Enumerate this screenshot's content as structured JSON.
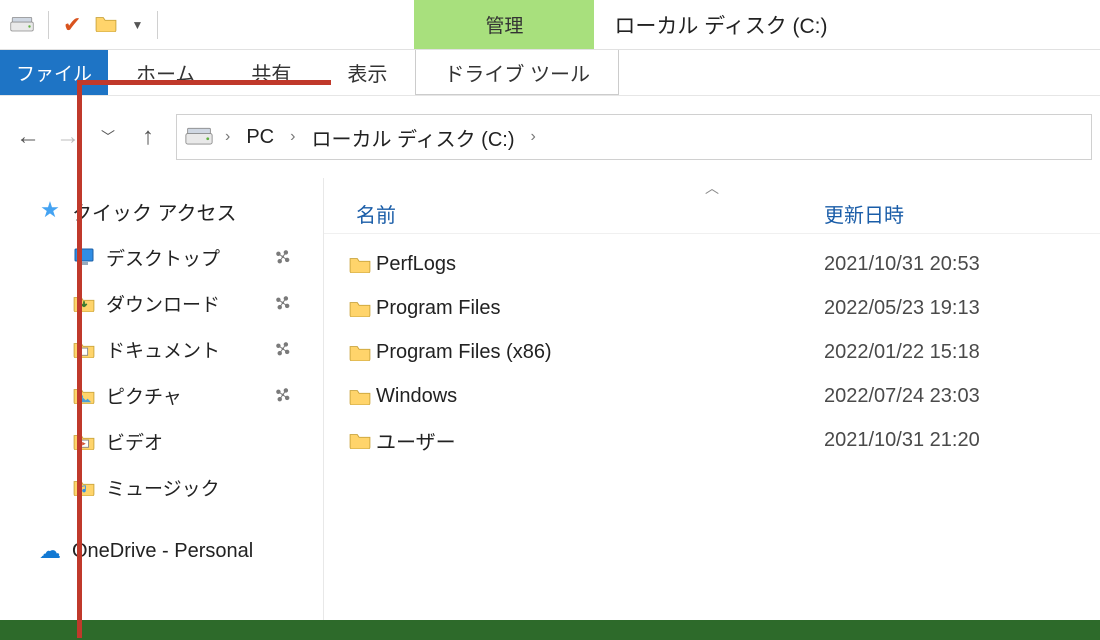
{
  "title": "ローカル ディスク (C:)",
  "context_tab": "管理",
  "ribbon": {
    "file": "ファイル",
    "home": "ホーム",
    "share": "共有",
    "view": "表示",
    "drive_tools": "ドライブ ツール"
  },
  "breadcrumb": {
    "pc": "PC",
    "drive": "ローカル ディスク (C:)"
  },
  "tree": {
    "quick_access": "クイック アクセス",
    "desktop": "デスクトップ",
    "downloads": "ダウンロード",
    "documents": "ドキュメント",
    "pictures": "ピクチャ",
    "videos": "ビデオ",
    "music": "ミュージック",
    "onedrive": "OneDrive - Personal"
  },
  "columns": {
    "name": "名前",
    "date": "更新日時"
  },
  "files": [
    {
      "name": "PerfLogs",
      "date": "2021/10/31 20:53"
    },
    {
      "name": "Program Files",
      "date": "2022/05/23 19:13"
    },
    {
      "name": "Program Files (x86)",
      "date": "2022/01/22 15:18"
    },
    {
      "name": "Windows",
      "date": "2022/07/24 23:03"
    },
    {
      "name": "ユーザー",
      "date": "2021/10/31 21:20"
    }
  ]
}
